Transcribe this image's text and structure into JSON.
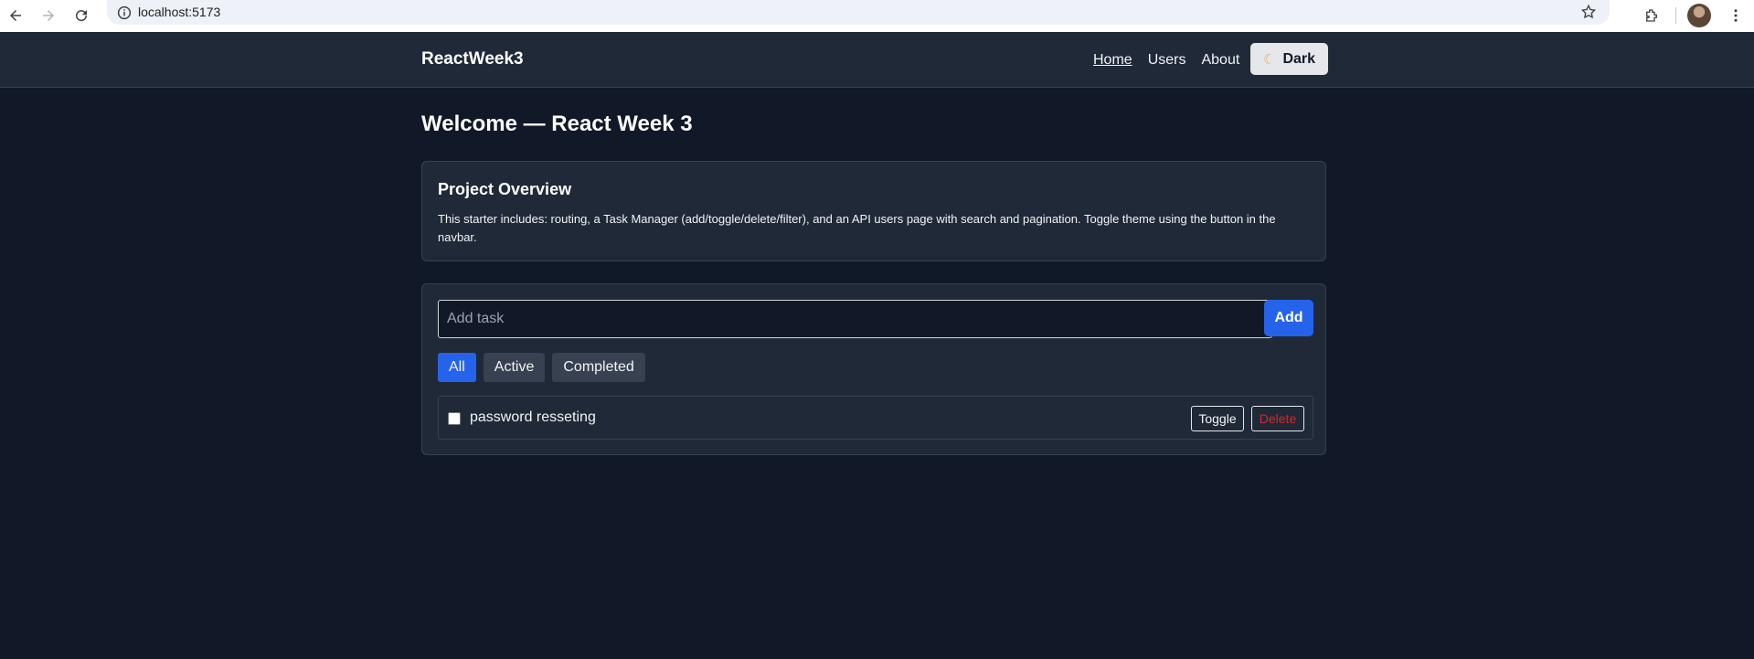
{
  "browser": {
    "url": "localhost:5173"
  },
  "navbar": {
    "brand": "ReactWeek3",
    "links": [
      {
        "label": "Home",
        "active": true
      },
      {
        "label": "Users",
        "active": false
      },
      {
        "label": "About",
        "active": false
      }
    ],
    "theme_button": {
      "icon": "moon-icon",
      "label": "Dark"
    }
  },
  "main": {
    "title": "Welcome — React Week 3",
    "overview": {
      "heading": "Project Overview",
      "text": "This starter includes: routing, a Task Manager (add/toggle/delete/filter), and an API users page with search and pagination. Toggle theme using the button in the navbar."
    },
    "task_manager": {
      "input_placeholder": "Add task",
      "input_value": "",
      "add_label": "Add",
      "filters": [
        {
          "label": "All",
          "selected": true
        },
        {
          "label": "Active",
          "selected": false
        },
        {
          "label": "Completed",
          "selected": false
        }
      ],
      "tasks": [
        {
          "text": "password resseting",
          "completed": false,
          "toggle_label": "Toggle",
          "delete_label": "Delete"
        }
      ]
    }
  },
  "colors": {
    "background": "#111827",
    "surface": "#1f2937",
    "accent": "#2563eb",
    "danger": "#dc2626"
  }
}
